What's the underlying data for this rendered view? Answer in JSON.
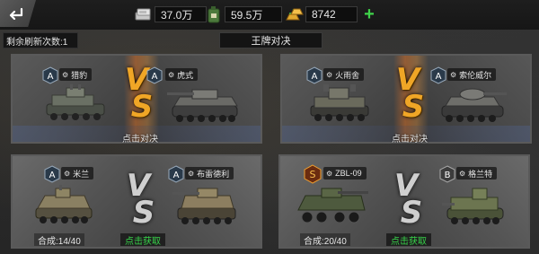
{
  "topbar": {
    "silver": "37.0万",
    "fuel": "59.5万",
    "gold": "8742"
  },
  "refresh_label": "剩余刷新次数:1",
  "tab_title": "王牌对决",
  "vs_letters": [
    "V",
    "S"
  ],
  "colors": {
    "plus": "#3fd24a",
    "vs_gold": "#f0a626",
    "get": "#37d44a"
  },
  "matchups": [
    {
      "left": {
        "rank": "A",
        "name": "猎豹"
      },
      "right": {
        "rank": "A",
        "name": "虎式"
      },
      "action": "点击对决"
    },
    {
      "left": {
        "rank": "A",
        "name": "火雨舍"
      },
      "right": {
        "rank": "A",
        "name": "索伦威尔"
      },
      "action": "点击对决"
    },
    {
      "left": {
        "rank": "A",
        "name": "米兰",
        "progress": "合成:14/40"
      },
      "right": {
        "rank": "A",
        "name": "布雷德利"
      },
      "action": "点击获取"
    },
    {
      "left": {
        "rank": "S",
        "name": "ZBL-09",
        "progress": "合成:20/40"
      },
      "right": {
        "rank": "B",
        "name": "格兰特"
      },
      "action": "点击获取"
    }
  ]
}
